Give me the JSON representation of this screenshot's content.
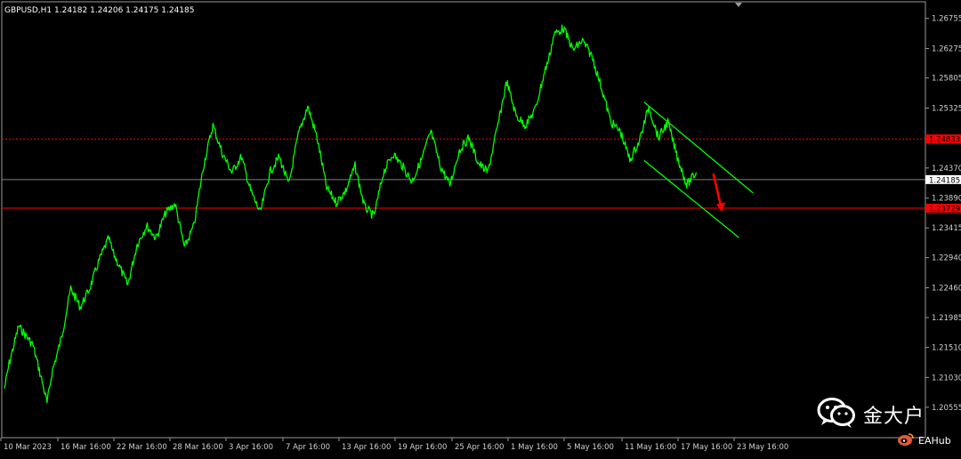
{
  "header": {
    "title": "GBPUSD,H1  1.24182 1.24206 1.24175 1.24185"
  },
  "colors": {
    "background": "#000000",
    "price_line": "#00ff00",
    "channel": "#00ff00",
    "support_resistance": "#ff0000",
    "arrow": "#ff0000",
    "current_price_line": "#808080",
    "axis_text": "#d0d0d0"
  },
  "chart_data": {
    "type": "line",
    "instrument": "GBPUSD",
    "timeframe": "H1",
    "ohlc": {
      "open": 1.24182,
      "high": 1.24206,
      "low": 1.24175,
      "close": 1.24185
    },
    "x_ticks": [
      "10 Mar 2023",
      "16 Mar 16:00",
      "22 Mar 16:00",
      "28 Mar 16:00",
      "3 Apr 16:00",
      "7 Apr 16:00",
      "13 Apr 16:00",
      "19 Apr 16:00",
      "25 Apr 16:00",
      "1 May 16:00",
      "5 May 16:00",
      "11 May 16:00",
      "17 May 16:00",
      "23 May 16:00"
    ],
    "y_ticks": [
      1.26755,
      1.26275,
      1.25805,
      1.25325,
      1.2437,
      1.2389,
      1.23415,
      1.2294,
      1.2246,
      1.21985,
      1.2151,
      1.2103,
      1.20555
    ],
    "ylim": [
      1.2007,
      1.2702
    ],
    "price_labels": {
      "resistance": 1.24833,
      "current": 1.24185,
      "support": 1.23729
    },
    "series": [
      {
        "x": [
          0,
          0.5,
          1.5,
          2,
          3,
          4,
          4.5,
          5,
          6,
          7,
          8,
          9,
          10,
          11,
          11.5,
          12,
          13,
          14,
          15,
          16,
          17,
          18,
          19,
          20,
          21,
          22,
          23,
          24,
          25,
          26,
          27,
          28,
          29,
          30,
          31,
          32,
          33,
          34,
          35,
          36,
          37,
          38,
          39,
          40,
          41,
          42,
          43,
          44,
          45,
          46,
          47,
          48,
          49,
          50,
          51,
          52,
          53,
          54,
          55,
          56,
          57,
          57.5,
          58,
          59,
          60,
          61,
          62,
          63,
          64,
          65,
          66,
          66.5,
          67,
          68,
          69,
          70,
          71,
          72,
          73
        ],
        "values": [
          1.2085,
          1.2125,
          1.2185,
          1.2175,
          1.2155,
          1.2095,
          1.2062,
          1.211,
          1.2165,
          1.2245,
          1.2215,
          1.2245,
          1.229,
          1.2325,
          1.23,
          1.2285,
          1.225,
          1.2315,
          1.2345,
          1.2325,
          1.2365,
          1.238,
          1.231,
          1.2345,
          1.244,
          1.2505,
          1.246,
          1.243,
          1.2455,
          1.24,
          1.2365,
          1.243,
          1.2455,
          1.241,
          1.249,
          1.2535,
          1.2485,
          1.2405,
          1.2382,
          1.24,
          1.244,
          1.2375,
          1.236,
          1.243,
          1.246,
          1.244,
          1.2415,
          1.245,
          1.2495,
          1.244,
          1.241,
          1.2465,
          1.2485,
          1.2445,
          1.243,
          1.25,
          1.2575,
          1.252,
          1.2505,
          1.253,
          1.259,
          1.2615,
          1.265,
          1.266,
          1.2625,
          1.264,
          1.2615,
          1.2565,
          1.251,
          1.2495,
          1.245,
          1.2465,
          1.248,
          1.2535,
          1.2485,
          1.251,
          1.2455,
          1.241,
          1.243
        ]
      }
    ],
    "channel": {
      "upper": {
        "x": [
          67.5,
          79
        ],
        "values": [
          1.2542,
          1.2397
        ]
      },
      "lower": {
        "x": [
          67.5,
          77.5
        ],
        "values": [
          1.2449,
          1.2326
        ]
      }
    },
    "horizontal_lines": [
      {
        "name": "resistance",
        "value": 1.24833,
        "style": "dotted"
      },
      {
        "name": "current",
        "value": 1.24185,
        "style": "solid"
      },
      {
        "name": "support",
        "value": 1.23729,
        "style": "solid"
      }
    ],
    "arrow": {
      "from": {
        "x": 74.8,
        "y": 1.2428
      },
      "to": {
        "x": 75.6,
        "y": 1.2368
      }
    }
  },
  "watermark": {
    "main_text": "金大户",
    "sub_text": "EAHub",
    "main_icon": "wechat-icon",
    "sub_icon": "weibo-icon"
  }
}
